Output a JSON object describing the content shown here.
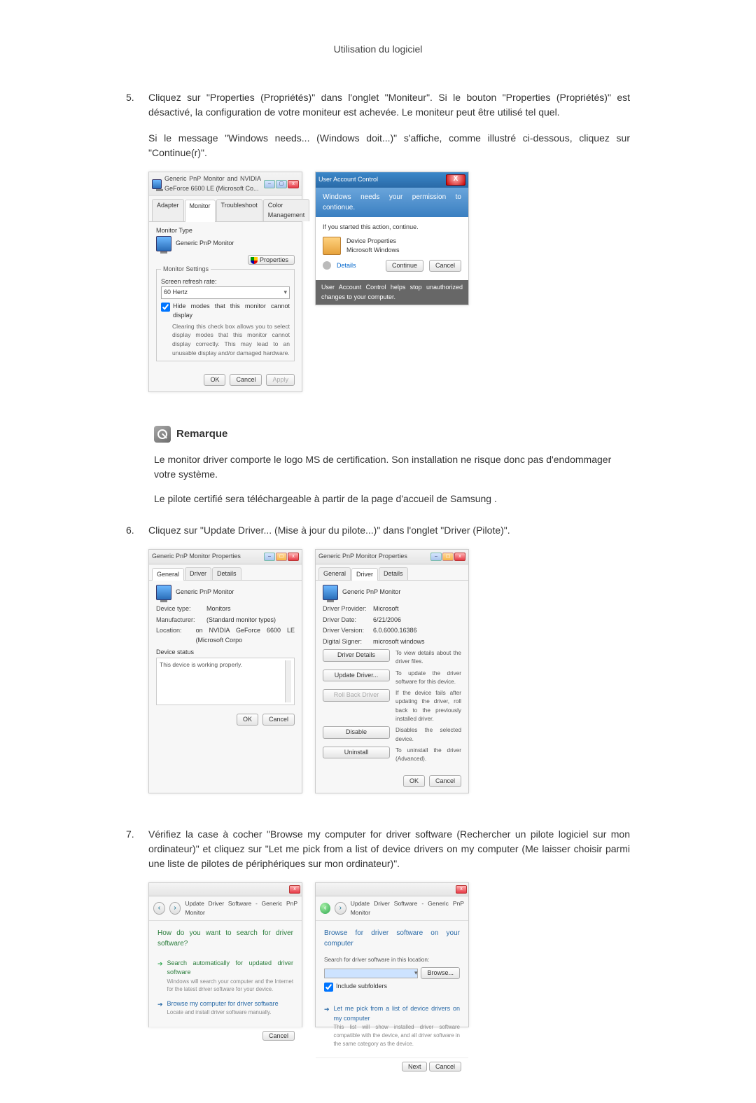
{
  "page_header": "Utilisation du logiciel",
  "steps": {
    "5": {
      "num": "5.",
      "para1": "Cliquez sur \"Properties (Propriétés)\" dans l'onglet \"Moniteur\". Si le bouton \"Properties (Propriétés)\" est désactivé, la configuration de votre moniteur est achevée. Le moniteur peut être utilisé tel quel.",
      "para2": "Si le message \"Windows needs... (Windows doit...)\" s'affiche, comme illustré ci-dessous, cliquez sur \"Continue(r)\"."
    },
    "6": {
      "num": "6.",
      "para1": "Cliquez sur \"Update Driver... (Mise à jour du pilote...)\" dans l'onglet \"Driver (Pilote)\"."
    },
    "7": {
      "num": "7.",
      "para1": "Vérifiez la case à cocher \"Browse my computer for driver software (Rechercher un pilote logiciel sur mon ordinateur)\" et cliquez sur \"Let me pick from a list of device drivers on my computer (Me laisser choisir parmi une liste de pilotes de périphériques sur mon ordinateur)\"."
    }
  },
  "note": {
    "heading": "Remarque",
    "para1": "Le monitor driver comporte le logo MS de certification. Son installation ne risque donc pas d'endommager votre système.",
    "para2": "Le pilote certifié sera téléchargeable à partir de la page d'accueil de Samsung ."
  },
  "dlg_monitor": {
    "title": "Generic PnP Monitor and NVIDIA GeForce 6600 LE (Microsoft Co...",
    "tabs": {
      "adapter": "Adapter",
      "monitor": "Monitor",
      "troubleshoot": "Troubleshoot",
      "color": "Color Management"
    },
    "group_type": "Monitor Type",
    "type_name": "Generic PnP Monitor",
    "properties_btn": "Properties",
    "group_settings": "Monitor Settings",
    "refresh_label": "Screen refresh rate:",
    "refresh_value": "60 Hertz",
    "hide_label": "Hide modes that this monitor cannot display",
    "hide_help": "Clearing this check box allows you to select display modes that this monitor cannot display correctly. This may lead to an unusable display and/or damaged hardware.",
    "ok": "OK",
    "cancel": "Cancel",
    "apply": "Apply"
  },
  "dlg_uac": {
    "hdr": "User Account Control",
    "banner": "Windows needs your permission to contionue.",
    "line1": "If you started this action, continue.",
    "dev_prop": "Device Properties",
    "msw": "Microsoft Windows",
    "details": "Details",
    "continue": "Continue",
    "cancel": "Cancel",
    "footer": "User Account Control helps stop unauthorized changes to your computer."
  },
  "dlg_prop_general": {
    "title": "Generic PnP Monitor Properties",
    "tabs": {
      "general": "General",
      "driver": "Driver",
      "details": "Details"
    },
    "name": "Generic PnP Monitor",
    "kv": {
      "dtype_k": "Device type:",
      "dtype_v": "Monitors",
      "man_k": "Manufacturer:",
      "man_v": "(Standard monitor types)",
      "loc_k": "Location:",
      "loc_v": "on NVIDIA GeForce 6600 LE (Microsoft Corpo"
    },
    "status_group": "Device status",
    "status_text": "This device is working properly.",
    "ok": "OK",
    "cancel": "Cancel"
  },
  "dlg_prop_driver": {
    "title": "Generic PnP Monitor Properties",
    "tabs": {
      "general": "General",
      "driver": "Driver",
      "details": "Details"
    },
    "name": "Generic PnP Monitor",
    "kv": {
      "prov_k": "Driver Provider:",
      "prov_v": "Microsoft",
      "date_k": "Driver Date:",
      "date_v": "6/21/2006",
      "ver_k": "Driver Version:",
      "ver_v": "6.0.6000.16386",
      "sig_k": "Digital Signer:",
      "sig_v": "microsoft windows"
    },
    "btn_det": "Driver Details",
    "btn_det_d": "To view details about the driver files.",
    "btn_upd": "Update Driver...",
    "btn_upd_d": "To update the driver software for this device.",
    "btn_roll": "Roll Back Driver",
    "btn_roll_d": "If the device fails after updating the driver, roll back to the previously installed driver.",
    "btn_dis": "Disable",
    "btn_dis_d": "Disables the selected device.",
    "btn_un": "Uninstall",
    "btn_un_d": "To uninstall the driver (Advanced).",
    "ok": "OK",
    "cancel": "Cancel"
  },
  "dlg_upd_left": {
    "trail": "Update Driver Software - Generic PnP Monitor",
    "question": "How do you want to search for driver software?",
    "opt1_t": "Search automatically for updated driver software",
    "opt1_d": "Windows will search your computer and the Internet for the latest driver software for your device.",
    "opt2_t": "Browse my computer for driver software",
    "opt2_d": "Locate and install driver software manually.",
    "cancel": "Cancel"
  },
  "dlg_upd_right": {
    "trail": "Update Driver Software - Generic PnP Monitor",
    "question": "Browse for driver software on your computer",
    "loc_label": "Search for driver software in this location:",
    "browse": "Browse...",
    "include": "Include subfolders",
    "opt_t": "Let me pick from a list of device drivers on my computer",
    "opt_d": "This list will show installed driver software compatible with the device, and all driver software in the same category as the device.",
    "next": "Next",
    "cancel": "Cancel"
  }
}
